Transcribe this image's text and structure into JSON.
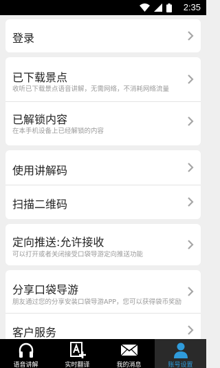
{
  "status_bar": {
    "time": "2:35"
  },
  "menu": {
    "login": {
      "title": "登录"
    },
    "downloaded": {
      "title": "已下载景点",
      "subtitle": "收听已下载景点语音讲解，无需网络，不消耗网络流量"
    },
    "unlocked": {
      "title": "已解锁内容",
      "subtitle": "在本手机设备上已经解锁的内容"
    },
    "code": {
      "title": "使用讲解码"
    },
    "qr": {
      "title": "扫描二维码"
    },
    "push": {
      "title": "定向推送:允许接收",
      "subtitle": "可以打开或者关闭接受口袋导游定向推送功能"
    },
    "share": {
      "title": "分享口袋导游",
      "subtitle": "朋友通过您的分享安装口袋导游APP，您可以获得袋币奖励"
    },
    "service": {
      "title": "客户服务"
    }
  },
  "tabs": [
    {
      "label": "语音讲解",
      "icon": "headphones-icon"
    },
    {
      "label": "实时翻译",
      "icon": "translate-icon"
    },
    {
      "label": "我的消息",
      "icon": "envelope-icon"
    },
    {
      "label": "账号设置",
      "icon": "person-icon",
      "active": true
    }
  ],
  "colors": {
    "accent": "#2f9bdb",
    "background": "#efefef",
    "bar": "#000000"
  }
}
